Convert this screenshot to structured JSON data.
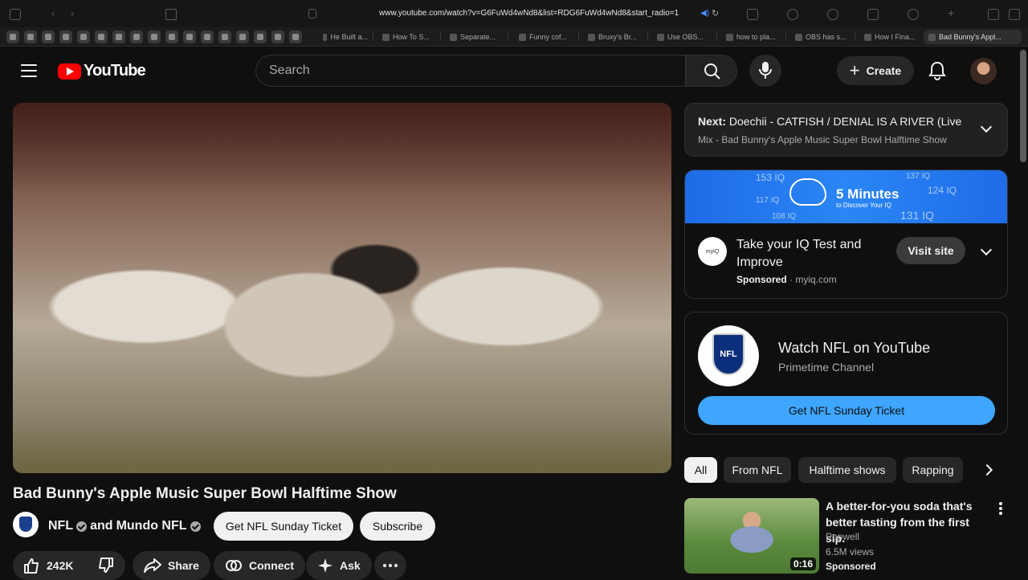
{
  "browser": {
    "url": "www.youtube.com/watch?v=G6FuWd4wNd8&list=RDG6FuWd4wNd8&start_radio=1",
    "tabs": [
      "He Built a...",
      "How To S...",
      "Separate...",
      "Funny cof...",
      "Bruxy's Br...",
      "Use OBS...",
      "how to pla...",
      "OBS has s...",
      "How I Fina...",
      "Bad Bunny's Appl..."
    ]
  },
  "header": {
    "logo_text": "YouTube",
    "search_placeholder": "Search",
    "create_label": "Create"
  },
  "video": {
    "title": "Bad Bunny's Apple Music Super Bowl Halftime Show",
    "channel": "NFL",
    "channel_join": "and",
    "channel2": "Mundo NFL",
    "ticket_button": "Get NFL Sunday Ticket",
    "subscribe_button": "Subscribe",
    "actions": {
      "likes": "242K",
      "share": "Share",
      "connect": "Connect",
      "ask": "Ask"
    }
  },
  "sidebar": {
    "next": {
      "label": "Next:",
      "title": "Doechii - CATFISH / DENIAL IS A RIVER (Live ...",
      "mix": "Mix - Bad Bunny's Apple Music Super Bowl Halftime Show"
    },
    "ad": {
      "banner_big": "5 Minutes",
      "banner_small": "to Discover Your IQ",
      "banner_iq": [
        "153 IQ",
        "117 IQ",
        "108 IQ",
        "137 IQ",
        "124 IQ",
        "131 IQ"
      ],
      "logo_text": "myiQ",
      "title": "Take your IQ Test and Improve",
      "sponsored": "Sponsored",
      "domain": "myiq.com",
      "visit": "Visit site"
    },
    "nfl_promo": {
      "logo_text": "NFL",
      "title": "Watch NFL on YouTube",
      "subtitle": "Primetime Channel",
      "button": "Get NFL Sunday Ticket"
    },
    "chips": [
      "All",
      "From NFL",
      "Halftime shows",
      "Rapping"
    ],
    "recommendation": {
      "title": "A better-for-you soda that's better tasting from the first sip.",
      "channel": "Popwell",
      "views": "6.5M views",
      "badge": "Sponsored",
      "duration": "0:16"
    }
  },
  "colors": {
    "background": "#0f0f0f",
    "brand_red": "#ff0000",
    "accent_blue": "#3ea6ff"
  }
}
